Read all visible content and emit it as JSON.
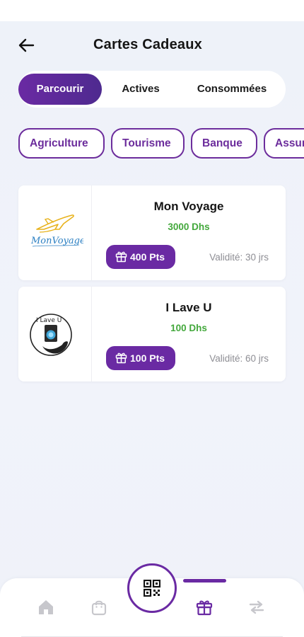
{
  "header": {
    "title": "Cartes Cadeaux",
    "back_icon": "arrow-left-icon"
  },
  "tabs": [
    {
      "label": "Parcourir",
      "active": true
    },
    {
      "label": "Actives",
      "active": false
    },
    {
      "label": "Consommées",
      "active": false
    }
  ],
  "categories": [
    "Agriculture",
    "Tourisme",
    "Banque",
    "Assurance"
  ],
  "cards": [
    {
      "name": "Mon Voyage",
      "amount": "3000 Dhs",
      "points": "400 Pts",
      "validity": "Validité: 30 jrs",
      "logo_text": "MonVoyage"
    },
    {
      "name": "I Lave U",
      "amount": "100 Dhs",
      "points": "100 Pts",
      "validity": "Validité: 60 jrs",
      "logo_text": "I Lave U"
    }
  ],
  "bottom_nav": {
    "items": [
      "home-icon",
      "shopping-bag-icon",
      "qr-code-icon",
      "gift-icon",
      "transfer-icon"
    ],
    "active": "gift-icon"
  },
  "colors": {
    "brand": "#6a2aa3",
    "amount": "#43a83c",
    "muted": "#8e8e94",
    "inactive_icon": "#c7c7cc"
  }
}
